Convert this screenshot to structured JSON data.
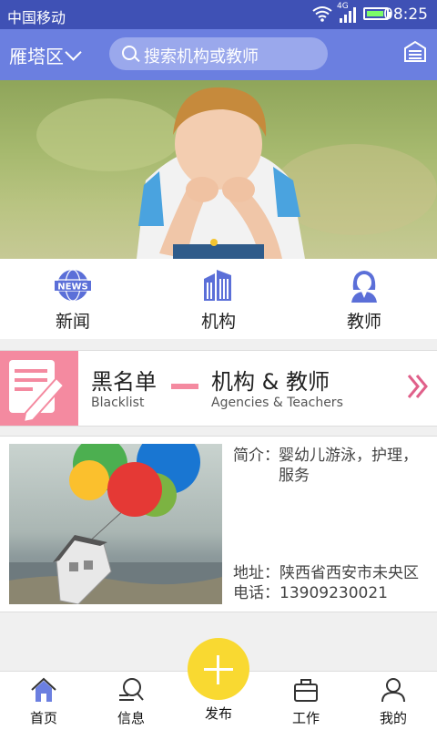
{
  "status": {
    "carrier": "中国移动",
    "network": "4G",
    "time": "08:25"
  },
  "header": {
    "region": "雁塔区",
    "search_placeholder": "搜索机构或教师"
  },
  "categories": [
    {
      "label": "新闻",
      "icon": "news-globe-icon"
    },
    {
      "label": "机构",
      "icon": "building-icon"
    },
    {
      "label": "教师",
      "icon": "teacher-icon"
    }
  ],
  "blacklist": {
    "title": "黑名单",
    "subtitle": "Blacklist",
    "title2": "机构 & 教师",
    "subtitle2": "Agencies & Teachers"
  },
  "card": {
    "intro_label": "简介：",
    "intro_text": "婴幼儿游泳，护理，服务",
    "address_label": "地址：",
    "address": "陕西省西安市未央区",
    "phone_label": "电话：",
    "phone": "13909230021"
  },
  "nav": [
    {
      "label": "首页",
      "icon": "home-icon"
    },
    {
      "label": "信息",
      "icon": "info-search-icon"
    },
    {
      "label": "发布",
      "icon": "plus-icon"
    },
    {
      "label": "工作",
      "icon": "briefcase-icon"
    },
    {
      "label": "我的",
      "icon": "user-icon"
    }
  ],
  "colors": {
    "status_bar": "#3f51b5",
    "header": "#6b7fe0",
    "accent_pink": "#f48aa0",
    "fab": "#f9d931"
  }
}
